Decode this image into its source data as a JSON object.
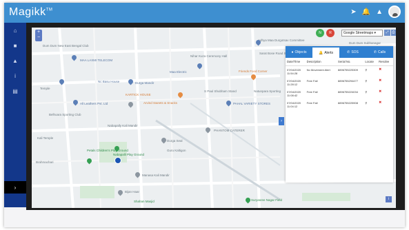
{
  "app": {
    "logo": "Magikk",
    "logo_mark": "TM",
    "accent": "#3e8fd0",
    "sidebar_color": "#13378a"
  },
  "topbar": {
    "icons": [
      "send-icon",
      "bell-icon",
      "user-icon"
    ],
    "send_glyph": "➤",
    "bell_glyph": "🔔",
    "user_glyph": "▲"
  },
  "sidebar": {
    "items": [
      {
        "icon": "home-icon",
        "glyph": "⌂"
      },
      {
        "icon": "folder-icon",
        "glyph": "■"
      },
      {
        "icon": "person-icon",
        "glyph": "▲"
      },
      {
        "icon": "info-icon",
        "glyph": "i"
      },
      {
        "icon": "report-icon",
        "glyph": "▤"
      }
    ],
    "toggle_glyph": "›"
  },
  "map": {
    "zoom_in": "+",
    "zoom_out": "−",
    "layer_buttons": [
      "N",
      "R"
    ],
    "map_type": "Google Streetmaps",
    "select_arrow": "▾",
    "fullscreen_glyph": "⤢",
    "print_glyph": "⎙",
    "collapse_glyph": "›",
    "corner_glyph": "i",
    "labels": [
      "Dum Dum New East Bengal Club",
      "MAA LAXMI TELECOM",
      "Adhya Maa Durgotsav Committee",
      "Nihar Kuza Ceremony Hall",
      "Sarat Bose Road Sarbojanin Durgotsav",
      "Friends Food Corner",
      "Nc Basu House",
      "Durga Mandir",
      "Maa Electric",
      "Temple",
      "KARTICK HOUSE",
      "All Leathers Pvt. Ltd",
      "Arvind Sweets & Snacks",
      "S Paul Shubham Stand",
      "Natunpara Sporting",
      "PAHAL VARIETY STORES",
      "Belhoara Sporting Club",
      "Kali Temple",
      "Nabapally Kali Mandir",
      "PHANTOM CATERER",
      "Durga Seal",
      "Guru Kaltigon",
      "Petals Children's Play Ground",
      "Nabapalli Play Ground",
      "Brahmachari",
      "Manasa Kali Mandir",
      "Bijan Haar",
      "Shahan Masjid",
      "Suryasree Nagar Field",
      "Dum Dum Subhanagar"
    ]
  },
  "panel": {
    "tabs": [
      {
        "label": "Objects",
        "icon": "location-icon",
        "glyph": "●"
      },
      {
        "label": "Alerts",
        "icon": "bell-icon",
        "glyph": "🔔"
      },
      {
        "label": "SOS",
        "icon": "sos-icon",
        "glyph": "✆"
      },
      {
        "label": "Calls",
        "icon": "phone-icon",
        "glyph": "✆"
      }
    ],
    "columns": [
      "Date/Time",
      "Description",
      "Serial No.",
      "Locate",
      "Resolve"
    ],
    "rows": [
      {
        "date": "07/04/2020",
        "time": "11:54:28",
        "desc": "No Movement Alert",
        "serial": "8896755225309",
        "locate": "⚲",
        "resolve": "✖"
      },
      {
        "date": "07/04/2020",
        "time": "11:28:12",
        "desc": "Free Fall",
        "serial": "8896755294477",
        "locate": "⚲",
        "resolve": "✖"
      },
      {
        "date": "07/04/2020",
        "time": "11:08:42",
        "desc": "Free Fall",
        "serial": "8896755224034",
        "locate": "⚲",
        "resolve": "✖"
      },
      {
        "date": "07/04/2020",
        "time": "11:04:12",
        "desc": "Free Fall",
        "serial": "8896755225908",
        "locate": "⚲",
        "resolve": "✖"
      }
    ]
  }
}
